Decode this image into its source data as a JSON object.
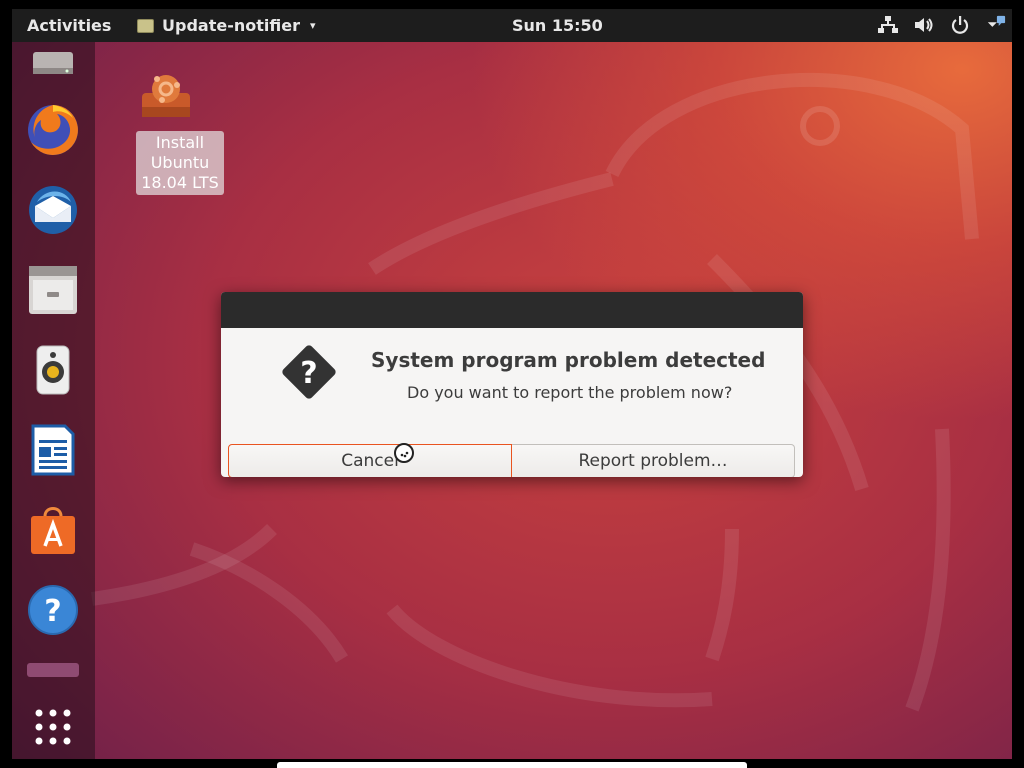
{
  "topbar": {
    "activities_label": "Activities",
    "app_name": "Update-notifier",
    "app_menu_caret": "▾",
    "clock": "Sun 15:50",
    "tray_icons": [
      "network-icon",
      "volume-icon",
      "power-icon",
      "notification-icon"
    ]
  },
  "dock": {
    "items": [
      {
        "name": "disk-icon"
      },
      {
        "name": "firefox-icon"
      },
      {
        "name": "thunderbird-icon"
      },
      {
        "name": "files-icon"
      },
      {
        "name": "rhythmbox-icon"
      },
      {
        "name": "libreoffice-writer-icon"
      },
      {
        "name": "ubuntu-software-icon"
      },
      {
        "name": "help-icon"
      },
      {
        "name": "amazon-icon"
      },
      {
        "name": "show-applications-icon"
      }
    ]
  },
  "desktop": {
    "install_icon_label": "Install Ubuntu 18.04 LTS"
  },
  "dialog": {
    "title": "System program problem detected",
    "message": "Do you want to report the problem now?",
    "cancel_label": "Cancel",
    "report_label": "Report problem…"
  },
  "colors": {
    "accent": "#e95420",
    "topbar_bg": "#1d1d1d",
    "dialog_bg": "#f6f5f4"
  }
}
